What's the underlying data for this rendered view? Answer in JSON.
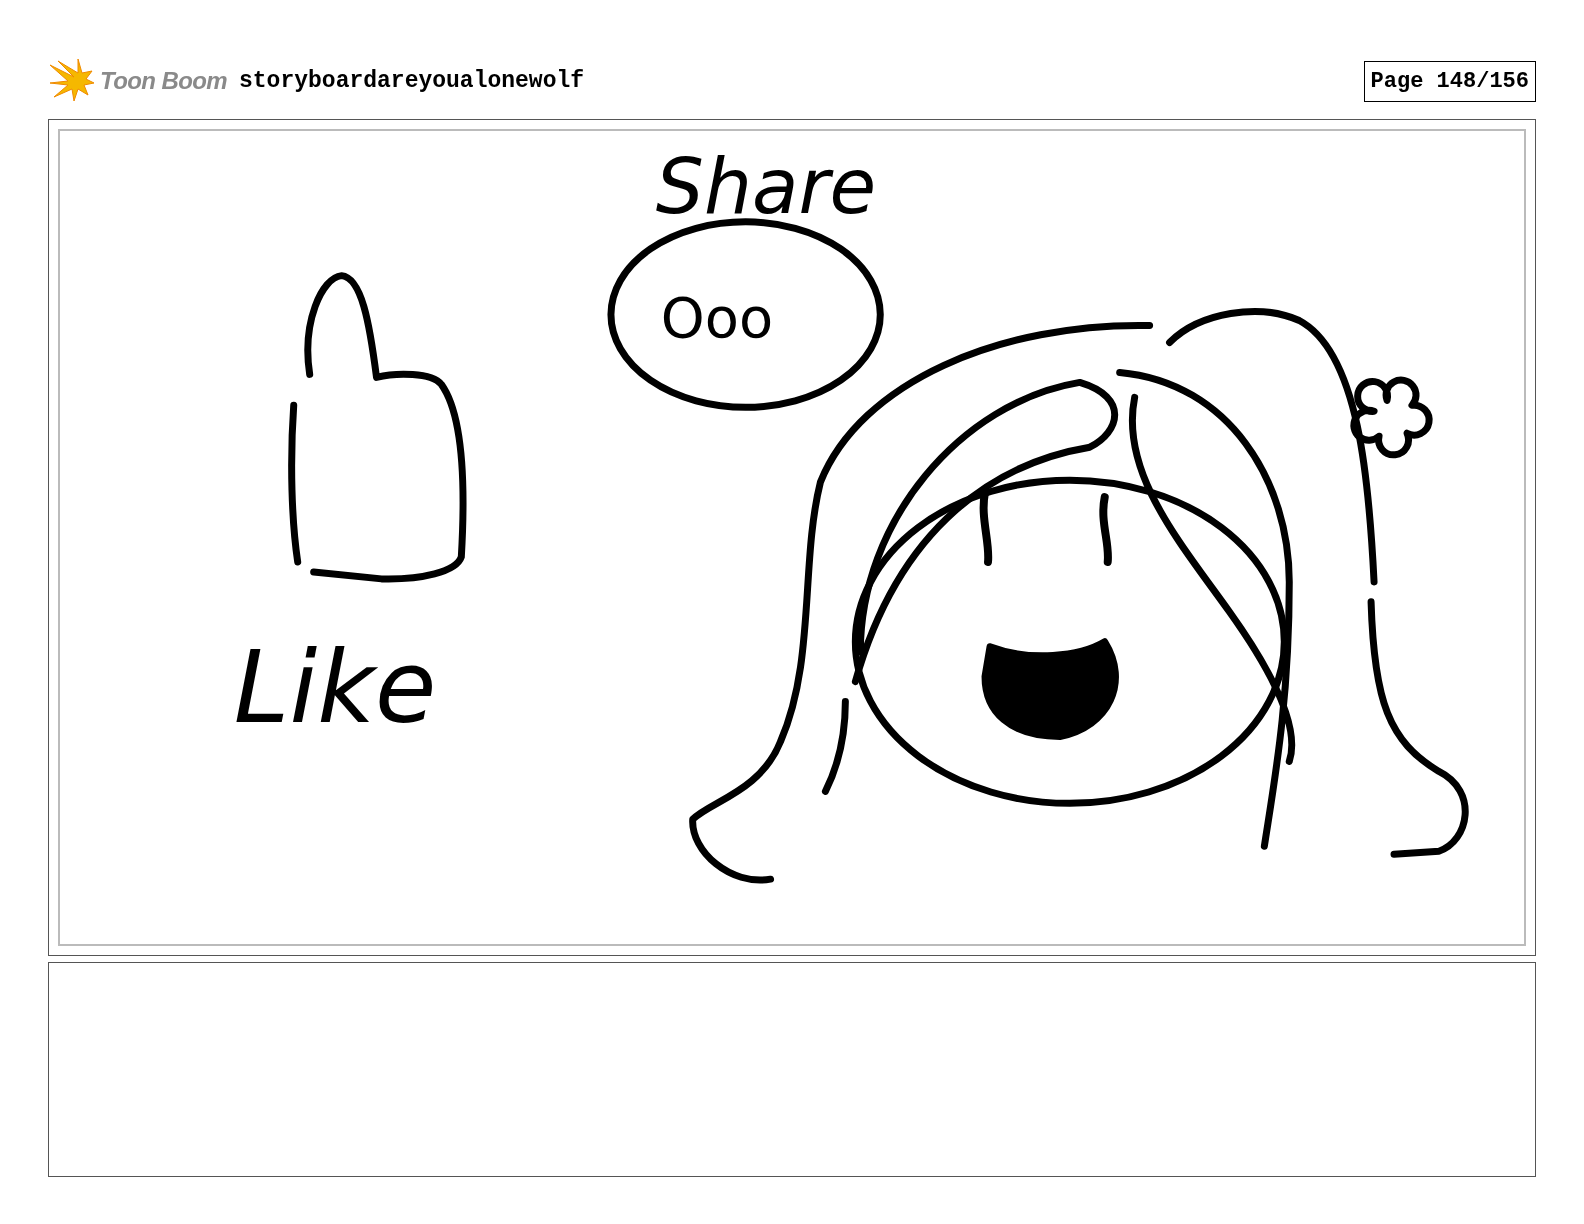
{
  "header": {
    "logo_text": "Toon Boom",
    "title": "storyboardareyoualonewolf",
    "page": "Page 148/156"
  },
  "panel": {
    "labels": [
      {
        "text": "Share"
      },
      {
        "text": "Ooo"
      },
      {
        "text": "Like"
      }
    ]
  }
}
